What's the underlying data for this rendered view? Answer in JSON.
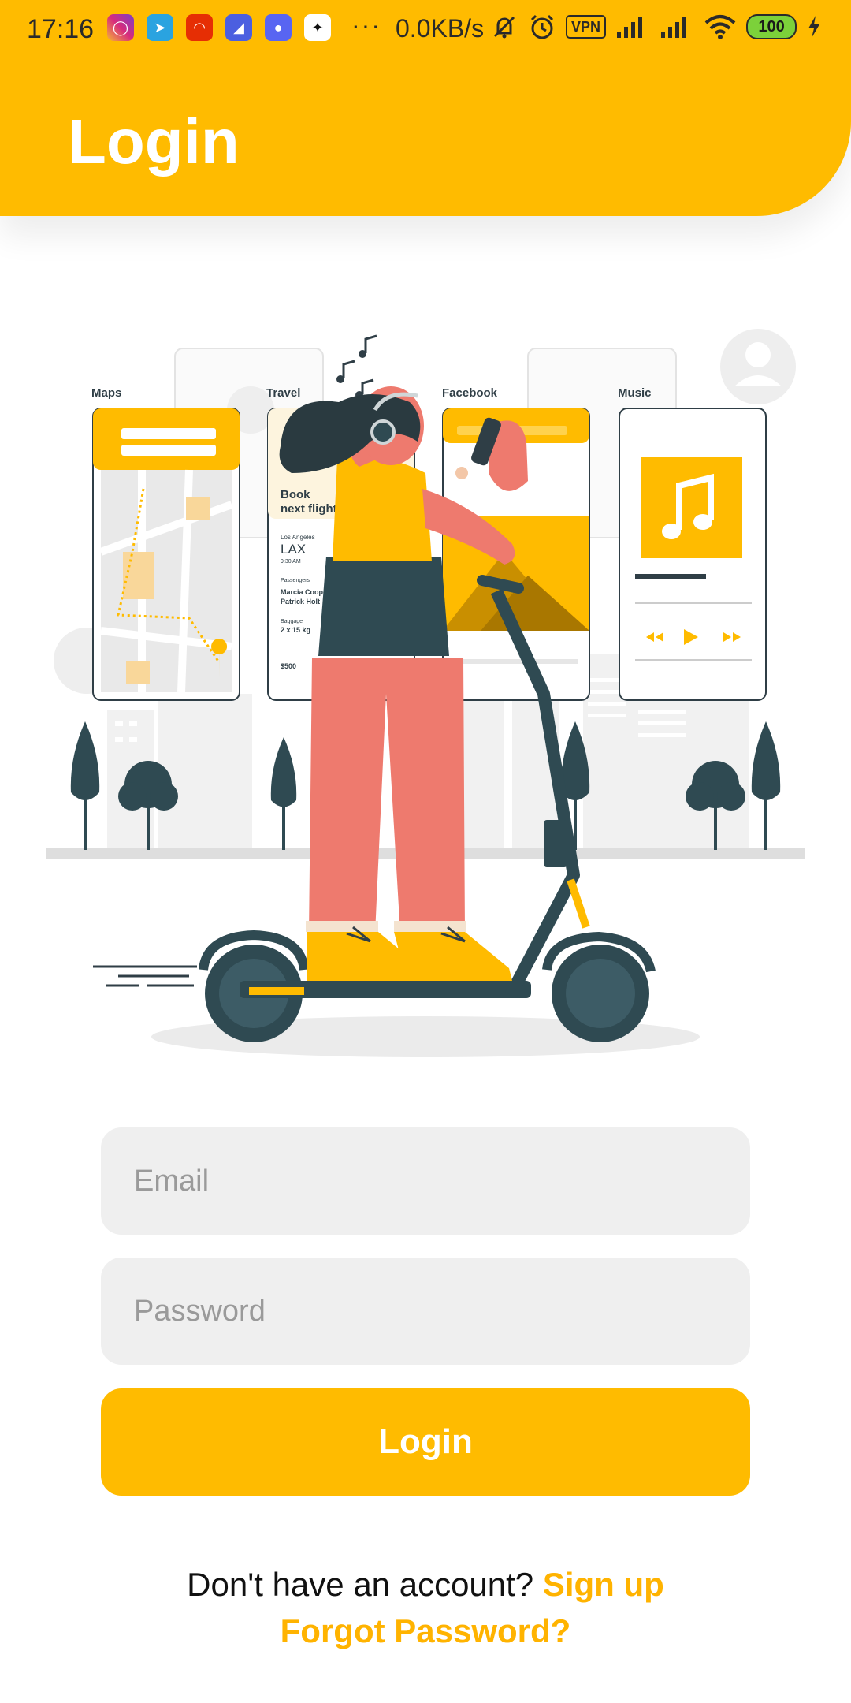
{
  "status_bar": {
    "time": "17:16",
    "more_indicator": "···",
    "network_speed": "0.0KB/s",
    "vpn_label": "VPN",
    "battery_level": "100",
    "app_icons": [
      "instagram-icon",
      "telegram-icon",
      "aliexpress-icon",
      "app-icon",
      "discord-icon",
      "app-icon"
    ],
    "status_icons": [
      "mute-icon",
      "alarm-icon",
      "vpn-icon",
      "signal-icon",
      "signal-icon",
      "wifi-icon",
      "battery-icon",
      "charging-icon"
    ]
  },
  "header": {
    "title": "Login",
    "background_color": "#FFBB00"
  },
  "illustration": {
    "screens": [
      {
        "label": "Maps"
      },
      {
        "label": "Travel",
        "lines": [
          "Book",
          "next flight",
          "Los Angeles",
          "LAX",
          "9:30 AM",
          "Passengers",
          "Marcia Coope",
          "Patrick Holt",
          "Baggage",
          "2 x 15 kg",
          "$500"
        ]
      },
      {
        "label": "Facebook"
      },
      {
        "label": "Music"
      }
    ]
  },
  "form": {
    "email_placeholder": "Email",
    "email_value": "",
    "password_placeholder": "Password",
    "password_value": "",
    "login_button": "Login"
  },
  "footer": {
    "signup_prompt": "Don't have an account?",
    "signup_link": "Sign up",
    "forgot_password": "Forgot Password?"
  },
  "colors": {
    "accent": "#FFBB00",
    "link": "#FFB300",
    "field_background": "#EFEFEF"
  }
}
